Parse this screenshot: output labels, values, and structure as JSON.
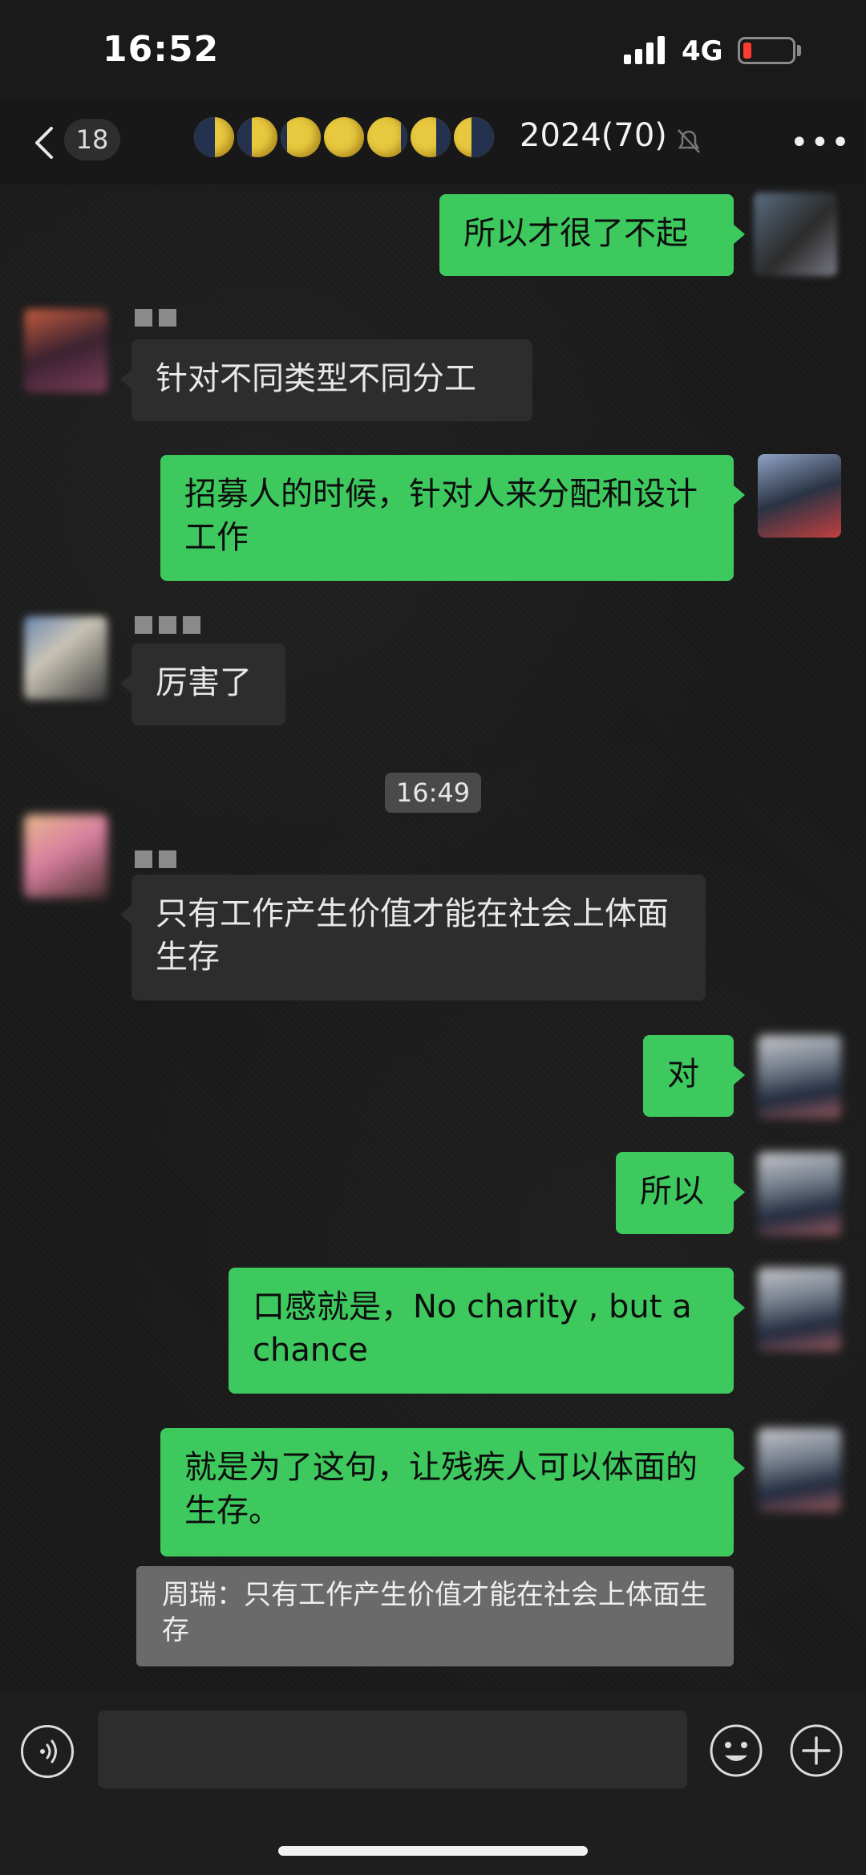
{
  "status": {
    "time": "16:52",
    "network": "4G"
  },
  "nav": {
    "unread": "18",
    "title": "2024(70)"
  },
  "messages": [
    {
      "from": "me",
      "text": "所以才很了不起"
    },
    {
      "from": "other",
      "text": "针对不同类型不同分工"
    },
    {
      "from": "me",
      "text": "招募人的时候，针对人来分配和设计工作"
    },
    {
      "from": "other",
      "text": "厉害了"
    },
    {
      "from": "other",
      "text": "只有工作产生价值才能在社会上体面生存"
    },
    {
      "from": "me",
      "text": "对"
    },
    {
      "from": "me",
      "text": "所以"
    },
    {
      "from": "me",
      "text": "口感就是，No charity , but a chance"
    },
    {
      "from": "me",
      "text": "就是为了这句，让残疾人可以体面的生存。"
    }
  ],
  "timestamp": "16:49",
  "quote": {
    "text": "周瑞：只有工作产生价值才能在社会上体面生存"
  },
  "input": {
    "placeholder": ""
  },
  "icons": {
    "back": "chevron-left-icon",
    "mute": "bell-off-icon",
    "more": "more-dots-icon",
    "voice": "voice-icon",
    "emoji": "emoji-icon",
    "plus": "plus-icon"
  },
  "colors": {
    "my_bubble": "#3ec95f",
    "other_bubble": "#2d2d2d",
    "background": "#1a1a1a"
  }
}
